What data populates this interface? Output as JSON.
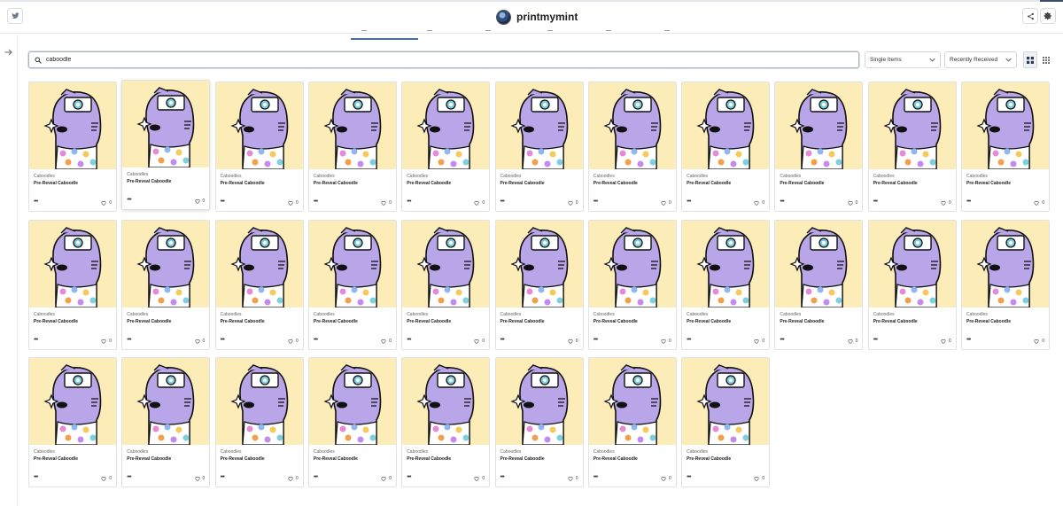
{
  "header": {
    "brand_name": "printmymint",
    "twitter_icon": "twitter-icon",
    "share_icon": "share-icon",
    "settings_icon": "gear-icon"
  },
  "toolbar": {
    "search_value": "caboodle",
    "search_icon": "search-icon",
    "type_filter": "Single Items",
    "sort_filter": "Recently Received",
    "view_large_icon": "grid-large-icon",
    "view_small_icon": "grid-small-icon"
  },
  "sidebar": {
    "expand_icon": "arrow-right-icon"
  },
  "colors": {
    "art_bg": "#fbecb8",
    "cat_body": "#b9a6e8",
    "accent": "#3f6fb5"
  },
  "cards": [
    {
      "collection": "Caboodles",
      "name": "Pre-Reveal Caboodle",
      "likes": "0"
    },
    {
      "collection": "Caboodles",
      "name": "Pre-Reveal Caboodle",
      "likes": "0"
    },
    {
      "collection": "Caboodles",
      "name": "Pre-Reveal Caboodle",
      "likes": "0"
    },
    {
      "collection": "Caboodles",
      "name": "Pre-Reveal Caboodle",
      "likes": "0"
    },
    {
      "collection": "Caboodles",
      "name": "Pre-Reveal Caboodle",
      "likes": "0"
    },
    {
      "collection": "Caboodles",
      "name": "Pre-Reveal Caboodle",
      "likes": "0"
    },
    {
      "collection": "Caboodles",
      "name": "Pre-Reveal Caboodle",
      "likes": "0"
    },
    {
      "collection": "Caboodles",
      "name": "Pre-Reveal Caboodle",
      "likes": "0"
    },
    {
      "collection": "Caboodles",
      "name": "Pre-Reveal Caboodle",
      "likes": "0"
    },
    {
      "collection": "Caboodles",
      "name": "Pre-Reveal Caboodle",
      "likes": "0"
    },
    {
      "collection": "Caboodles",
      "name": "Pre-Reveal Caboodle",
      "likes": "0"
    },
    {
      "collection": "Caboodles",
      "name": "Pre-Reveal Caboodle",
      "likes": "0"
    },
    {
      "collection": "Caboodles",
      "name": "Pre-Reveal Caboodle",
      "likes": "0"
    },
    {
      "collection": "Caboodles",
      "name": "Pre-Reveal Caboodle",
      "likes": "0"
    },
    {
      "collection": "Caboodles",
      "name": "Pre-Reveal Caboodle",
      "likes": "0"
    },
    {
      "collection": "Caboodles",
      "name": "Pre-Reveal Caboodle",
      "likes": "0"
    },
    {
      "collection": "Caboodles",
      "name": "Pre-Reveal Caboodle",
      "likes": "0"
    },
    {
      "collection": "Caboodles",
      "name": "Pre-Reveal Caboodle",
      "likes": "0"
    },
    {
      "collection": "Caboodles",
      "name": "Pre-Reveal Caboodle",
      "likes": "0"
    },
    {
      "collection": "Caboodles",
      "name": "Pre-Reveal Caboodle",
      "likes": "0"
    },
    {
      "collection": "Caboodles",
      "name": "Pre-Reveal Caboodle",
      "likes": "0"
    },
    {
      "collection": "Caboodles",
      "name": "Pre-Reveal Caboodle",
      "likes": "0"
    },
    {
      "collection": "Caboodles",
      "name": "Pre-Reveal Caboodle",
      "likes": "0"
    },
    {
      "collection": "Caboodles",
      "name": "Pre-Reveal Caboodle",
      "likes": "0"
    },
    {
      "collection": "Caboodles",
      "name": "Pre-Reveal Caboodle",
      "likes": "0"
    },
    {
      "collection": "Caboodles",
      "name": "Pre-Reveal Caboodle",
      "likes": "0"
    },
    {
      "collection": "Caboodles",
      "name": "Pre-Reveal Caboodle",
      "likes": "0"
    },
    {
      "collection": "Caboodles",
      "name": "Pre-Reveal Caboodle",
      "likes": "0"
    },
    {
      "collection": "Caboodles",
      "name": "Pre-Reveal Caboodle",
      "likes": "0"
    },
    {
      "collection": "Caboodles",
      "name": "Pre-Reveal Caboodle",
      "likes": "0"
    }
  ]
}
